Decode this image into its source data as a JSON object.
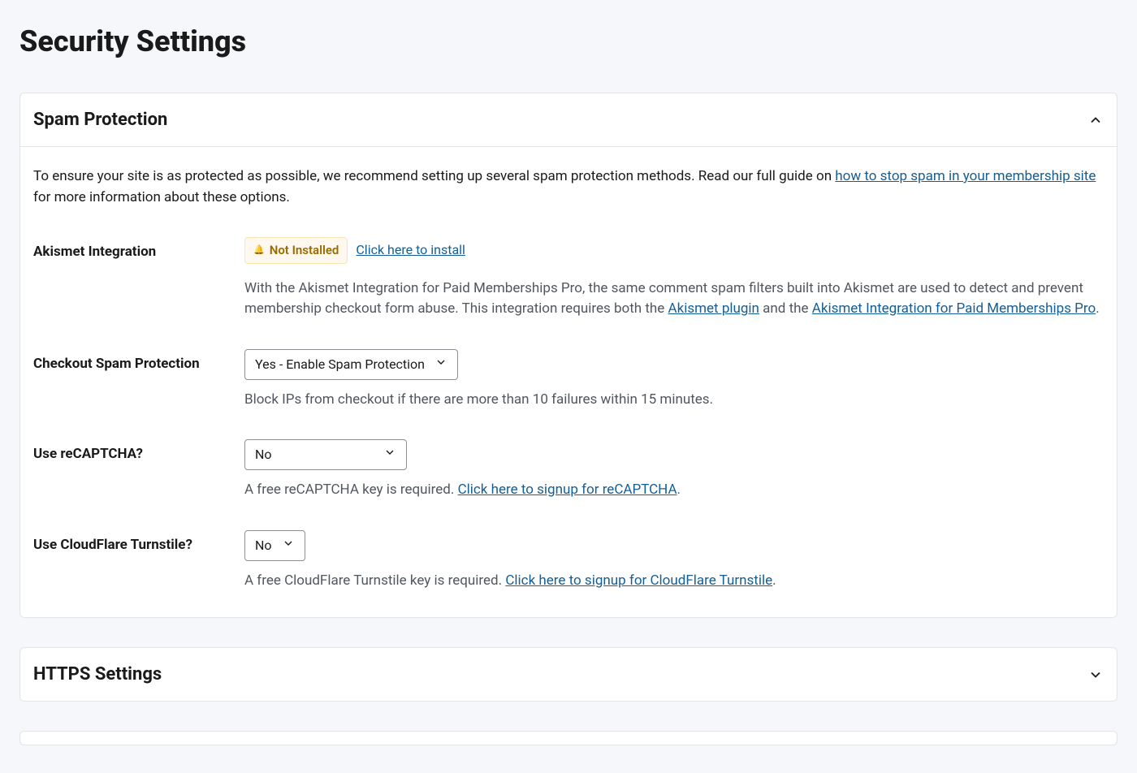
{
  "page": {
    "title": "Security Settings"
  },
  "panels": {
    "spam": {
      "title": "Spam Protection",
      "expanded": true,
      "intro_pre": "To ensure your site is as protected as possible, we recommend setting up several spam protection methods. Read our full guide on ",
      "intro_link": "how to stop spam in your membership site",
      "intro_post": " for more information about these options.",
      "akismet": {
        "label": "Akismet Integration",
        "badge": "Not Installed",
        "install_link": "Click here to install",
        "desc_pre": "With the Akismet Integration for Paid Memberships Pro, the same comment spam filters built into Akismet are used to detect and prevent membership checkout form abuse. This integration requires both the ",
        "link1": "Akismet plugin",
        "mid": " and the ",
        "link2": "Akismet Integration for Paid Memberships Pro",
        "desc_post": "."
      },
      "checkout": {
        "label": "Checkout Spam Protection",
        "value": "Yes - Enable Spam Protection",
        "helper": "Block IPs from checkout if there are more than 10 failures within 15 minutes."
      },
      "recaptcha": {
        "label": "Use reCAPTCHA?",
        "value": "No",
        "helper_pre": "A free reCAPTCHA key is required. ",
        "helper_link": "Click here to signup for reCAPTCHA",
        "helper_post": "."
      },
      "turnstile": {
        "label": "Use CloudFlare Turnstile?",
        "value": "No",
        "helper_pre": "A free CloudFlare Turnstile key is required. ",
        "helper_link": "Click here to signup for CloudFlare Turnstile",
        "helper_post": "."
      }
    },
    "https": {
      "title": "HTTPS Settings",
      "expanded": false
    }
  }
}
